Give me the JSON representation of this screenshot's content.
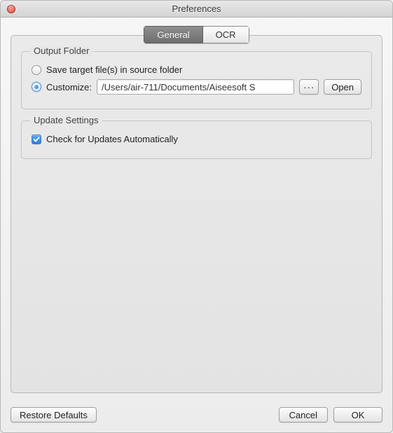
{
  "window": {
    "title": "Preferences"
  },
  "tabs": {
    "general": "General",
    "ocr": "OCR"
  },
  "output_folder": {
    "legend": "Output Folder",
    "save_in_source": "Save target file(s) in source folder",
    "customize_label": "Customize:",
    "path": "/Users/air-711/Documents/Aiseesoft S",
    "browse": "···",
    "open": "Open"
  },
  "update_settings": {
    "legend": "Update Settings",
    "auto_check": "Check for Updates Automatically"
  },
  "footer": {
    "restore": "Restore Defaults",
    "cancel": "Cancel",
    "ok": "OK"
  }
}
